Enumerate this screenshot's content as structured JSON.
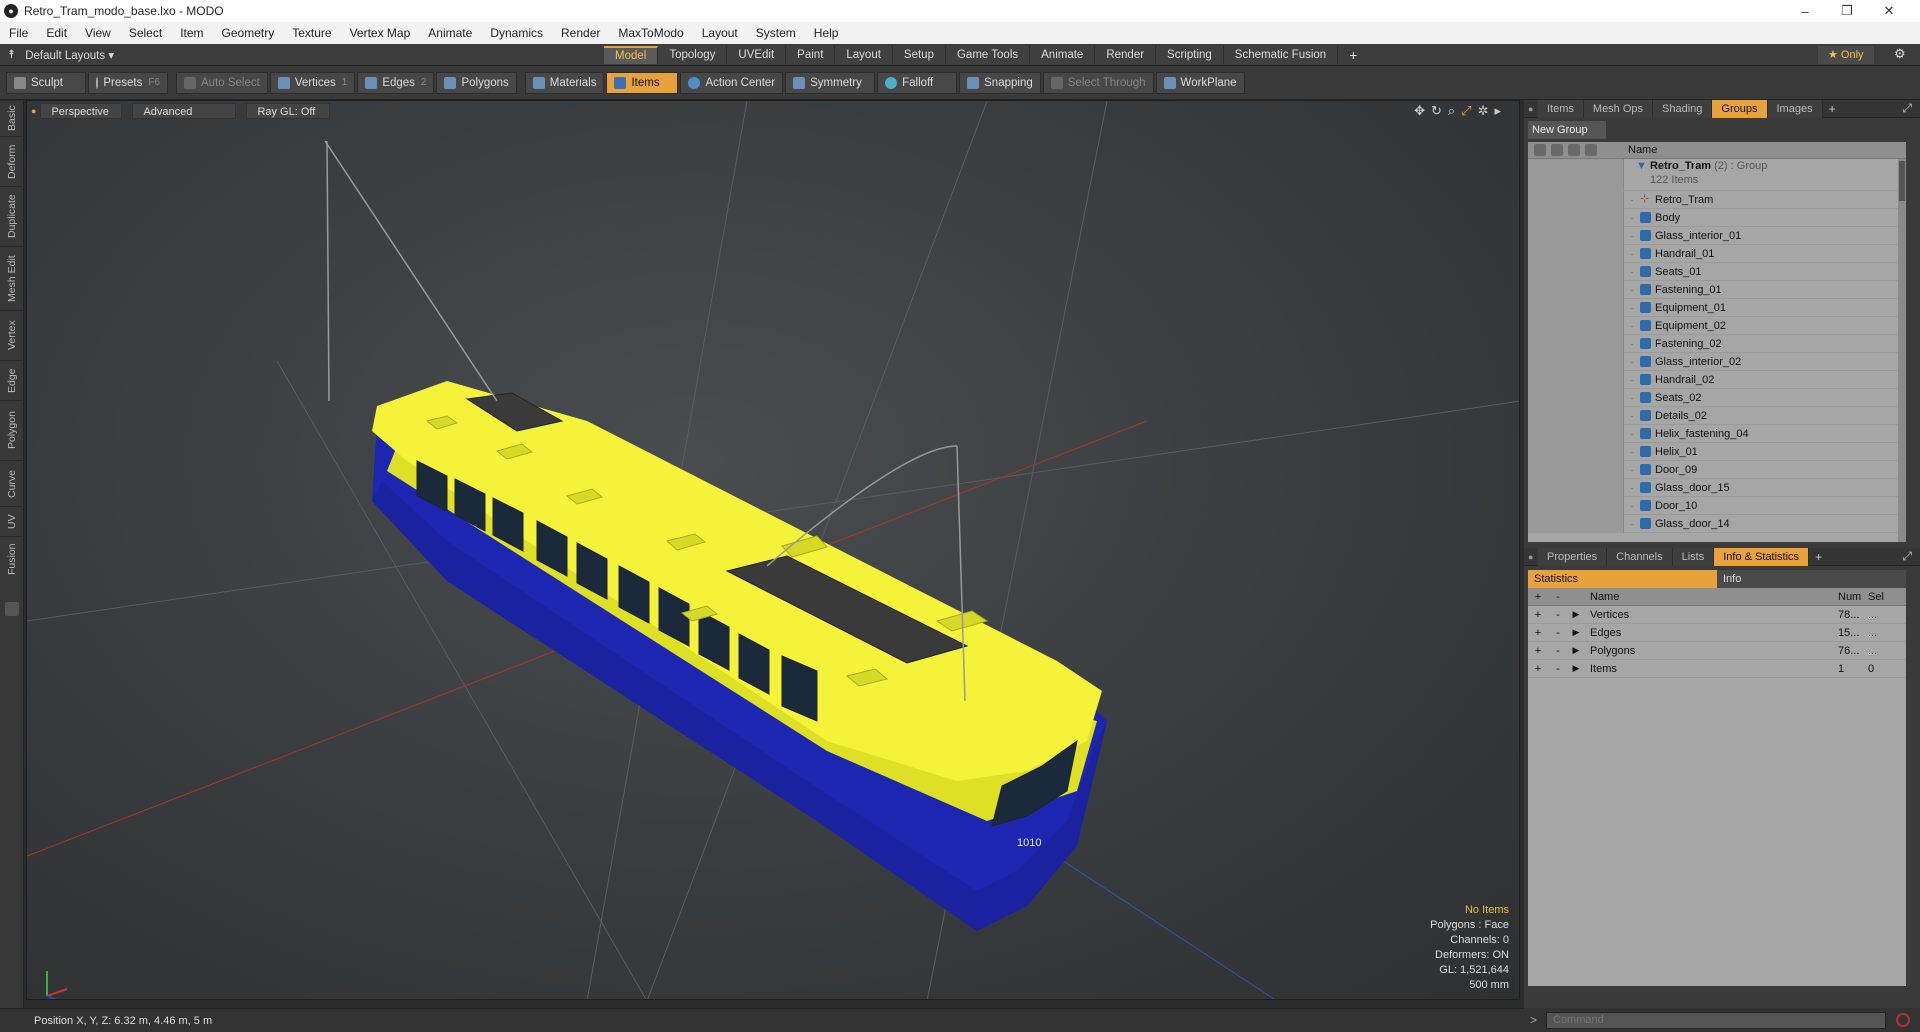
{
  "window": {
    "title": "Retro_Tram_modo_base.lxo - MODO",
    "controls": [
      "–",
      "❐",
      "✕"
    ]
  },
  "menu": [
    "File",
    "Edit",
    "View",
    "Select",
    "Item",
    "Geometry",
    "Texture",
    "Vertex Map",
    "Animate",
    "Dynamics",
    "Render",
    "MaxToModo",
    "Layout",
    "System",
    "Help"
  ],
  "layout": {
    "name": "Default Layouts ▾",
    "tabs": [
      "Model",
      "Topology",
      "UVEdit",
      "Paint",
      "Layout",
      "Setup",
      "Game Tools",
      "Animate",
      "Render",
      "Scripting",
      "Schematic Fusion"
    ],
    "active_tab": "Model",
    "add": "+",
    "only_label": "★ Only",
    "gear": "⚙"
  },
  "toolbar": {
    "sculpt": "Sculpt",
    "presets": "Presets",
    "presets_key": "F6",
    "auto_select": "Auto Select",
    "vertices": "Vertices",
    "vertices_key": "1",
    "edges": "Edges",
    "edges_key": "2",
    "polygons": "Polygons",
    "materials": "Materials",
    "items": "Items",
    "action_center": "Action Center",
    "symmetry": "Symmetry",
    "falloff": "Falloff",
    "snapping": "Snapping",
    "select_through": "Select Through",
    "workplane": "WorkPlane"
  },
  "left_tabs": [
    "Basic",
    "Deform",
    "Duplicate",
    "Mesh Edit",
    "Vertex",
    "Edge",
    "Polygon",
    "Curve",
    "UV",
    "Fusion"
  ],
  "viewport": {
    "perspective": "Perspective",
    "advanced": "Advanced",
    "raygl": "Ray GL: Off",
    "stats": {
      "no_items": "No Items",
      "polygons": "Polygons : Face",
      "channels": "Channels: 0",
      "deformers": "Deformers: ON",
      "gl": "GL: 1,521,644",
      "scale": "500 mm"
    },
    "tram_number": "1010"
  },
  "status": {
    "position": "Position X, Y, Z:   6.32 m, 4.46 m, 5 m"
  },
  "panel_top": {
    "tabs": [
      "Items",
      "Mesh Ops",
      "Shading",
      "Groups",
      "Images"
    ],
    "active": "Groups",
    "new_group": "New Group",
    "name_col": "Name",
    "group": {
      "name": "Retro_Tram",
      "count": "(2) : Group",
      "items": "122 Items"
    },
    "rows": [
      "Retro_Tram",
      "Body",
      "Glass_interior_01",
      "Handrail_01",
      "Seats_01",
      "Fastening_01",
      "Equipment_01",
      "Equipment_02",
      "Fastening_02",
      "Glass_interior_02",
      "Handrail_02",
      "Seats_02",
      "Details_02",
      "Helix_fastening_04",
      "Helix_01",
      "Door_09",
      "Glass_door_15",
      "Door_10",
      "Glass_door_14"
    ]
  },
  "panel_bottom": {
    "tabs": [
      "Properties",
      "Channels",
      "Lists",
      "Info & Statistics"
    ],
    "active": "Info & Statistics",
    "subtabs": [
      "Statistics",
      "Info"
    ],
    "headers": {
      "name": "Name",
      "num": "Num",
      "sel": "Sel"
    },
    "rows": [
      {
        "name": "Vertices",
        "num": "78...",
        "sel": "..."
      },
      {
        "name": "Edges",
        "num": "15...",
        "sel": "..."
      },
      {
        "name": "Polygons",
        "num": "76...",
        "sel": "..."
      },
      {
        "name": "Items",
        "num": "1",
        "sel": "0"
      }
    ]
  },
  "command": {
    "placeholder": "Command"
  }
}
